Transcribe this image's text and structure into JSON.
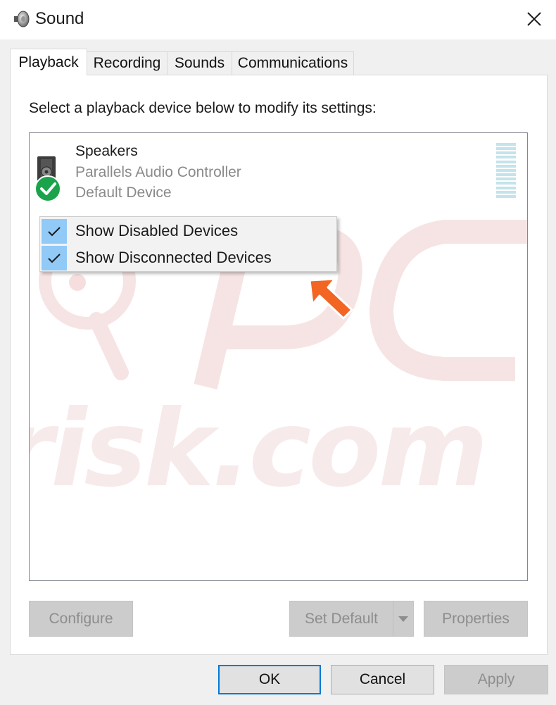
{
  "window": {
    "title": "Sound",
    "app_icon": "speaker-icon",
    "close_icon": "close-icon"
  },
  "tabs": [
    {
      "label": "Playback",
      "active": true
    },
    {
      "label": "Recording",
      "active": false
    },
    {
      "label": "Sounds",
      "active": false
    },
    {
      "label": "Communications",
      "active": false
    }
  ],
  "playback": {
    "instruction": "Select a playback device below to modify its settings:",
    "device": {
      "name": "Speakers",
      "description": "Parallels Audio Controller",
      "status": "Default Device",
      "icon": "speaker-device-icon",
      "status_icon": "green-checkmark-icon"
    }
  },
  "context_menu": {
    "items": [
      {
        "label": "Show Disabled Devices",
        "checked": true
      },
      {
        "label": "Show Disconnected Devices",
        "checked": true
      }
    ]
  },
  "panel_buttons": {
    "configure": "Configure",
    "set_default": "Set Default",
    "properties": "Properties"
  },
  "dialog_buttons": {
    "ok": "OK",
    "cancel": "Cancel",
    "apply": "Apply"
  },
  "watermark": {
    "text": "risk.com"
  },
  "colors": {
    "accent": "#0078d7",
    "menu_check_highlight": "#91c9f7",
    "arrow": "#f26522",
    "check_green": "#16a34a"
  }
}
